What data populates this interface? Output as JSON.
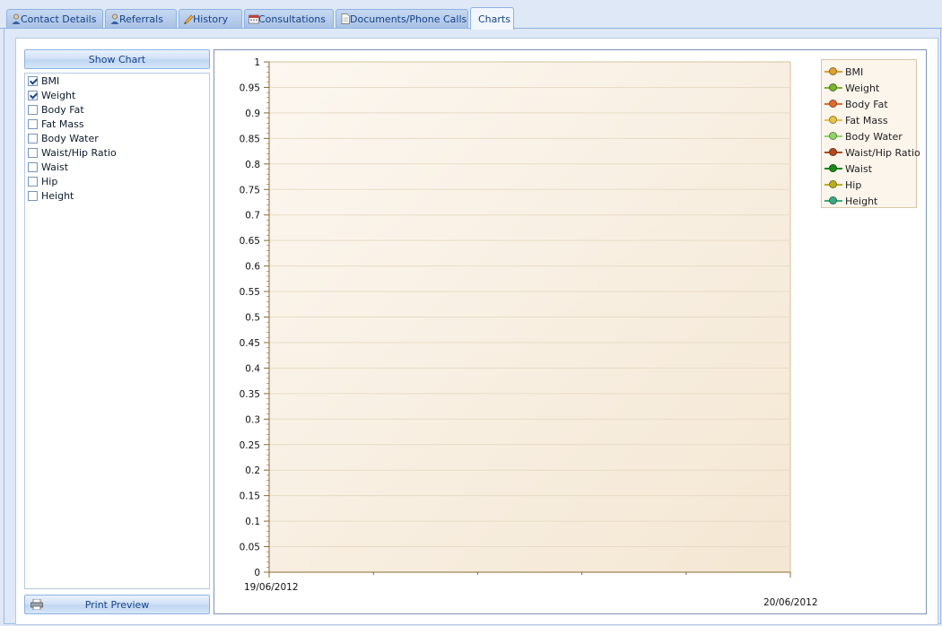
{
  "tabs": [
    {
      "label": "Contact Details",
      "icon": "person-icon",
      "active": false
    },
    {
      "label": "Referrals",
      "icon": "person-icon",
      "active": false
    },
    {
      "label": "History",
      "icon": "pencil-icon",
      "active": false
    },
    {
      "label": "Consultations",
      "icon": "calendar-icon",
      "active": false
    },
    {
      "label": "Documents/Phone Calls",
      "icon": "document-icon",
      "active": false
    },
    {
      "label": "Charts",
      "icon": "",
      "active": true
    }
  ],
  "left_panel": {
    "show_chart_label": "Show Chart",
    "print_preview_label": "Print Preview",
    "metrics": [
      {
        "label": "BMI",
        "checked": true
      },
      {
        "label": "Weight",
        "checked": true
      },
      {
        "label": "Body Fat",
        "checked": false
      },
      {
        "label": "Fat Mass",
        "checked": false
      },
      {
        "label": "Body Water",
        "checked": false
      },
      {
        "label": "Waist/Hip Ratio",
        "checked": false
      },
      {
        "label": "Waist",
        "checked": false
      },
      {
        "label": "Hip",
        "checked": false
      },
      {
        "label": "Height",
        "checked": false
      }
    ]
  },
  "chart_data": {
    "type": "line",
    "ylim": [
      0,
      1
    ],
    "y_ticks": [
      "0",
      "0.05",
      "0.1",
      "0.15",
      "0.2",
      "0.25",
      "0.3",
      "0.35",
      "0.4",
      "0.45",
      "0.5",
      "0.55",
      "0.6",
      "0.65",
      "0.7",
      "0.75",
      "0.8",
      "0.85",
      "0.9",
      "0.95",
      "1"
    ],
    "x_ticks": [
      "19/06/2012",
      "20/06/2012"
    ],
    "legend_position": "top-right",
    "grid": true,
    "series": [
      {
        "name": "BMI",
        "color": "#e0a030",
        "values": []
      },
      {
        "name": "Weight",
        "color": "#7ab32e",
        "values": []
      },
      {
        "name": "Body Fat",
        "color": "#e06a30",
        "values": []
      },
      {
        "name": "Fat Mass",
        "color": "#e8c24a",
        "values": []
      },
      {
        "name": "Body Water",
        "color": "#8fd46a",
        "values": []
      },
      {
        "name": "Waist/Hip Ratio",
        "color": "#b04a20",
        "values": []
      },
      {
        "name": "Waist",
        "color": "#1a8a1a",
        "values": []
      },
      {
        "name": "Hip",
        "color": "#b8b020",
        "values": []
      },
      {
        "name": "Height",
        "color": "#3aaa80",
        "values": []
      }
    ]
  }
}
